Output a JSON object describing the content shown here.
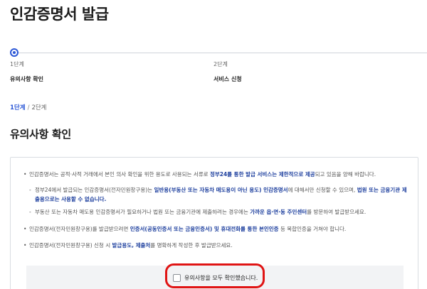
{
  "page": {
    "title": "인감증명서 발급"
  },
  "steps": [
    {
      "num": "1단계",
      "name": "유의사항 확인",
      "active": true
    },
    {
      "num": "2단계",
      "name": "서비스 신청",
      "active": false
    }
  ],
  "breadcrumb": {
    "current": "1단계",
    "separator": "/",
    "next": "2단계"
  },
  "section": {
    "title": "유의사항 확인"
  },
  "notices": {
    "item1": {
      "pre": "인감증명서는 공적·사적 거래에서 본인 의사 확인을 위한 용도로 사용되는 서류로 ",
      "bold": "정부24를 통한 발급 서비스는 제한적으로 제공",
      "post": "되고 있음을 양해 바랍니다."
    },
    "sub1": {
      "pre": "정부24에서 발급되는 인감증명서(전자민원창구용)는 ",
      "bold1": "일반용(부동산 또는 자동차 매도용이 아닌 용도) 인감증명서",
      "mid": "에 대해서만 신청할 수 있으며, ",
      "bold2": "법원 또는 금융기관 제출용으로는 사용할 수 없습니다."
    },
    "sub2": {
      "pre": "부동산 또는 자동차 매도용 인감증명서가 필요하거나 법원 또는 금융기관에 제출하려는 경우에는 ",
      "bold": "가까운 읍·면·동 주민센터",
      "post": "를 방문하여 발급받으세요."
    },
    "item2": {
      "pre": "인감증명서(전자민원창구용)를 발급받으려면 ",
      "bold": "인증서(공동인증서 또는 금융인증서) 및 휴대전화를 통한 본인인증",
      "post": " 등 복합인증을 거쳐야 합니다."
    },
    "item3": {
      "pre": "인감증명서(전자민원창구용) 신청 시 ",
      "bold": "발급용도, 제출처",
      "post": "를 명확하게 작성한 후 발급받으세요."
    }
  },
  "confirm": {
    "label": "유의사항을 모두 확인했습니다.",
    "checked": false
  },
  "colors": {
    "accent": "#2b57d6",
    "emphasis": "#1d3f9e",
    "highlight": "#e01414"
  }
}
